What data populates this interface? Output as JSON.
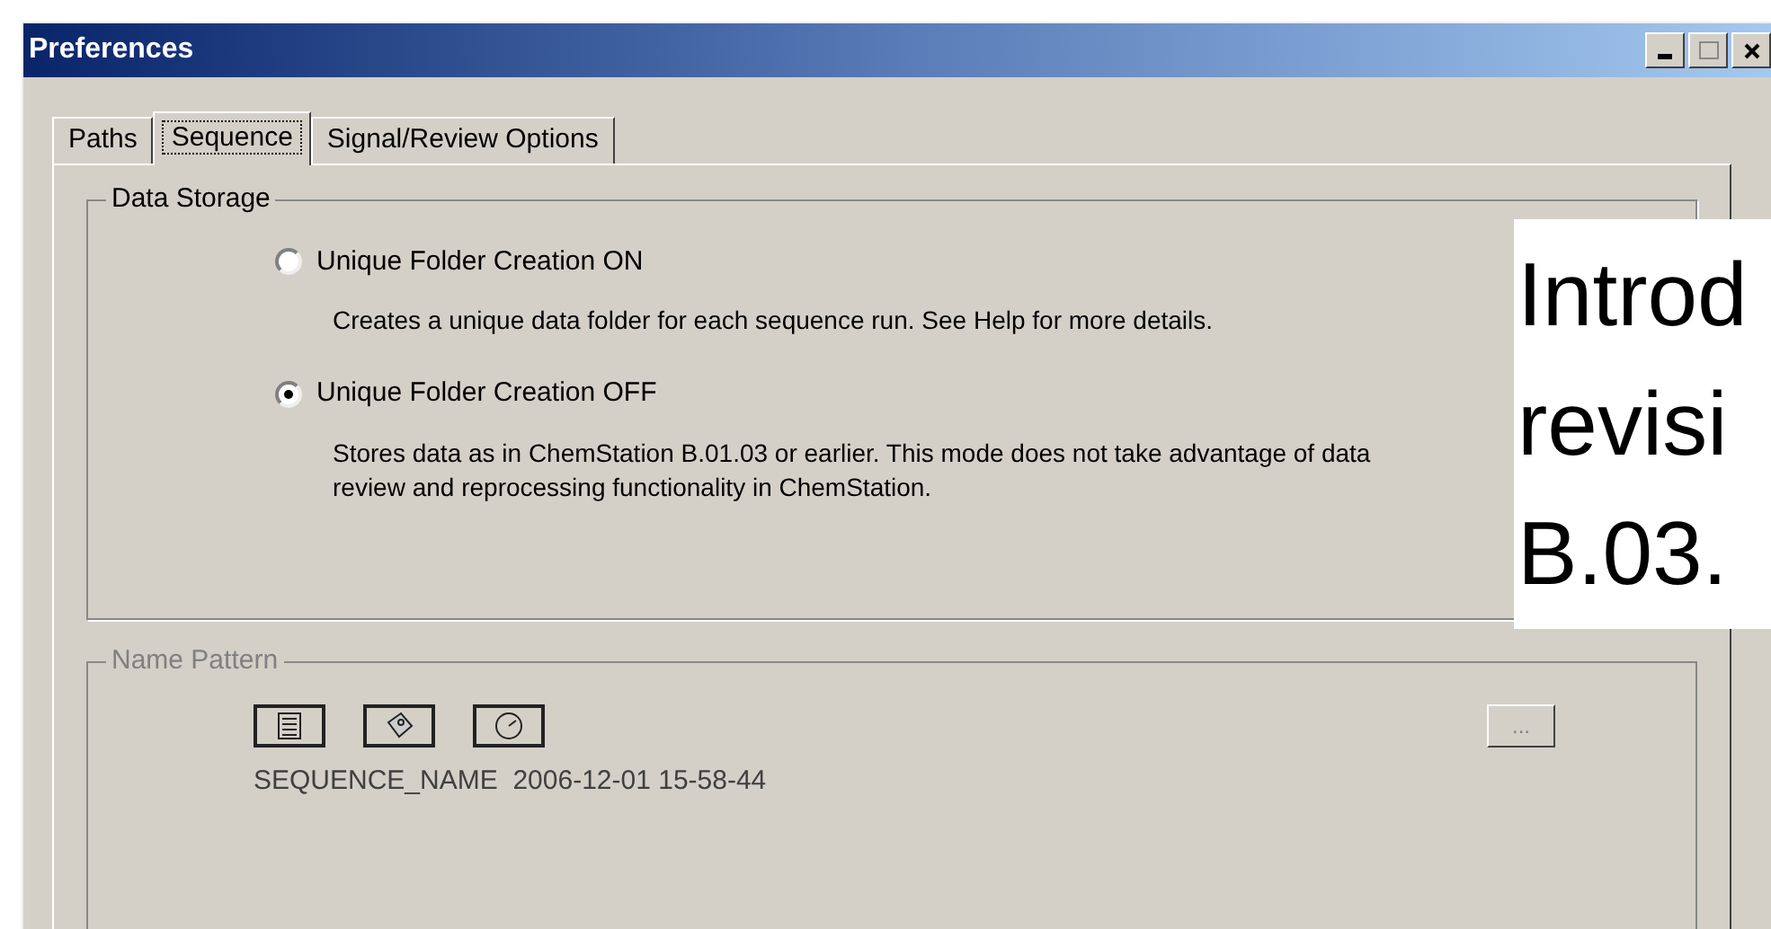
{
  "window": {
    "title": "Preferences"
  },
  "tabs": [
    {
      "label": "Paths",
      "selected": false
    },
    {
      "label": "Sequence",
      "selected": true
    },
    {
      "label": "Signal/Review Options",
      "selected": false
    }
  ],
  "data_storage": {
    "title": "Data Storage",
    "options": [
      {
        "label": "Unique Folder Creation ON",
        "selected": false,
        "description": "Creates a unique data folder for each sequence run. See Help for more details."
      },
      {
        "label": "Unique Folder Creation OFF",
        "selected": true,
        "description": "Stores data as in ChemStation B.01.03 or earlier. This mode does not take advantage of data review and reprocessing functionality in ChemStation."
      }
    ]
  },
  "name_pattern": {
    "title": "Name Pattern",
    "disabled": true,
    "preview": "SEQUENCE_NAME  2006-12-01 15-58-44",
    "browse_button": "..."
  },
  "overlay": {
    "lines": [
      "Introd",
      "revisi",
      "B.03."
    ]
  }
}
